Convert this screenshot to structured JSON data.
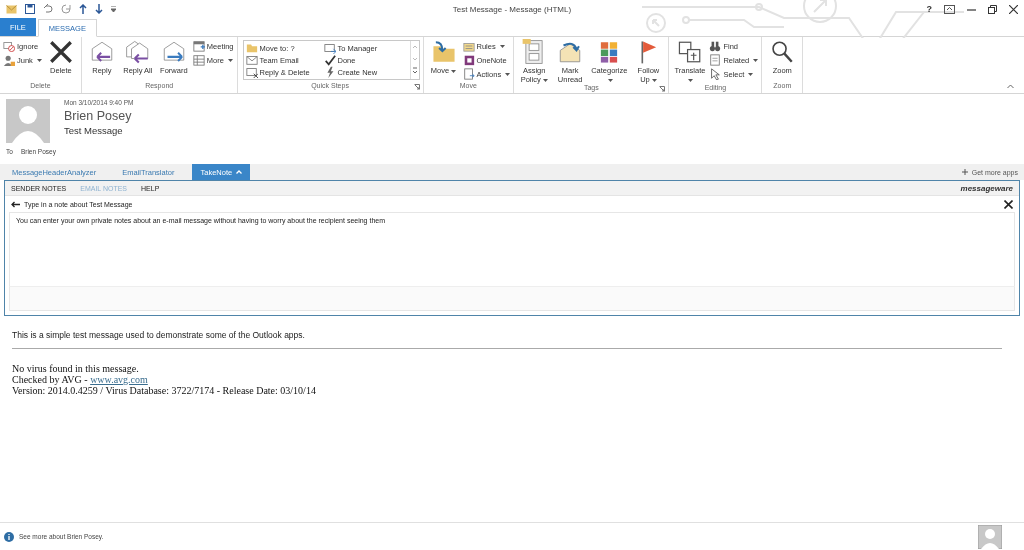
{
  "window": {
    "title": "Test Message - Message (HTML)",
    "help": "?"
  },
  "ribbon_tabs": [
    {
      "label": "FILE",
      "kind": "file",
      "selected": false
    },
    {
      "label": "MESSAGE",
      "kind": "tab",
      "selected": true
    }
  ],
  "ribbon_groups": [
    {
      "label": "Delete",
      "launcher": false,
      "items": [
        {
          "kind": "stack",
          "items": [
            {
              "label": "Ignore",
              "dropdown": false
            },
            {
              "label": "Junk",
              "dropdown": true
            }
          ]
        },
        {
          "kind": "large",
          "label": "Delete",
          "dropdown": false
        }
      ]
    },
    {
      "label": "Respond",
      "launcher": false,
      "items": [
        {
          "kind": "large",
          "label": "Reply",
          "dropdown": false
        },
        {
          "kind": "large",
          "label": "Reply All",
          "dropdown": false
        },
        {
          "kind": "large",
          "label": "Forward",
          "dropdown": false
        },
        {
          "kind": "stack",
          "items": [
            {
              "label": "Meeting",
              "dropdown": false
            },
            {
              "label": "More",
              "dropdown": true
            }
          ]
        }
      ]
    },
    {
      "label": "Quick Steps",
      "launcher": true,
      "items": [
        {
          "kind": "gallery",
          "items": [
            {
              "label": "Move to: ?"
            },
            {
              "label": "To Manager"
            },
            {
              "label": "Team Email"
            },
            {
              "label": "Done"
            },
            {
              "label": "Reply & Delete"
            },
            {
              "label": "Create New"
            }
          ]
        }
      ]
    },
    {
      "label": "Move",
      "launcher": false,
      "items": [
        {
          "kind": "large",
          "label": "Move",
          "dropdown": true
        },
        {
          "kind": "stack",
          "items": [
            {
              "label": "Rules",
              "dropdown": true
            },
            {
              "label": "OneNote",
              "dropdown": false
            },
            {
              "label": "Actions",
              "dropdown": true
            }
          ]
        }
      ]
    },
    {
      "label": "Tags",
      "launcher": true,
      "items": [
        {
          "kind": "large",
          "label": "Assign Policy",
          "dropdown": true
        },
        {
          "kind": "large",
          "label": "Mark Unread",
          "dropdown": false
        },
        {
          "kind": "large",
          "label": "Categorize",
          "dropdown": true
        },
        {
          "kind": "large",
          "label": "Follow Up",
          "dropdown": true
        }
      ]
    },
    {
      "label": "Editing",
      "launcher": false,
      "items": [
        {
          "kind": "large",
          "label": "Translate",
          "dropdown": true
        },
        {
          "kind": "stack",
          "items": [
            {
              "label": "Find",
              "dropdown": false
            },
            {
              "label": "Related",
              "dropdown": true
            },
            {
              "label": "Select",
              "dropdown": true
            }
          ]
        }
      ]
    },
    {
      "label": "Zoom",
      "launcher": false,
      "items": [
        {
          "kind": "large",
          "label": "Zoom",
          "dropdown": false
        }
      ]
    }
  ],
  "message": {
    "date": "Mon 3/10/2014 9:40 PM",
    "sender": "Brien Posey",
    "subject": "Test Message",
    "to_label": "To",
    "to": "Brien Posey"
  },
  "app_tabs": [
    {
      "label": "MessageHeaderAnalyzer",
      "selected": false
    },
    {
      "label": "EmailTranslator",
      "selected": false
    },
    {
      "label": "TakeNote",
      "selected": true
    }
  ],
  "get_more_apps": "Get more apps",
  "takenote": {
    "tabs": [
      {
        "label": "SENDER NOTES",
        "selected": false
      },
      {
        "label": "EMAIL NOTES",
        "selected": true
      },
      {
        "label": "HELP",
        "selected": false
      }
    ],
    "logo": "messageware",
    "prompt": "Type in a note about Test Message",
    "note": "You can enter your own private notes about an e-mail message without having to worry about the recipient seeing them"
  },
  "body": {
    "text": "This is a simple test message used to demonstrate some of the Outlook apps.",
    "avg": [
      "No virus found in this message."
    ],
    "checked_by": "Checked by AVG - ",
    "link": "www.avg.com",
    "version": "Version: 2014.0.4259 / Virus Database: 3722/7174 - Release Date: 03/10/14"
  },
  "footer": {
    "text": "See more about Brien Posey."
  }
}
